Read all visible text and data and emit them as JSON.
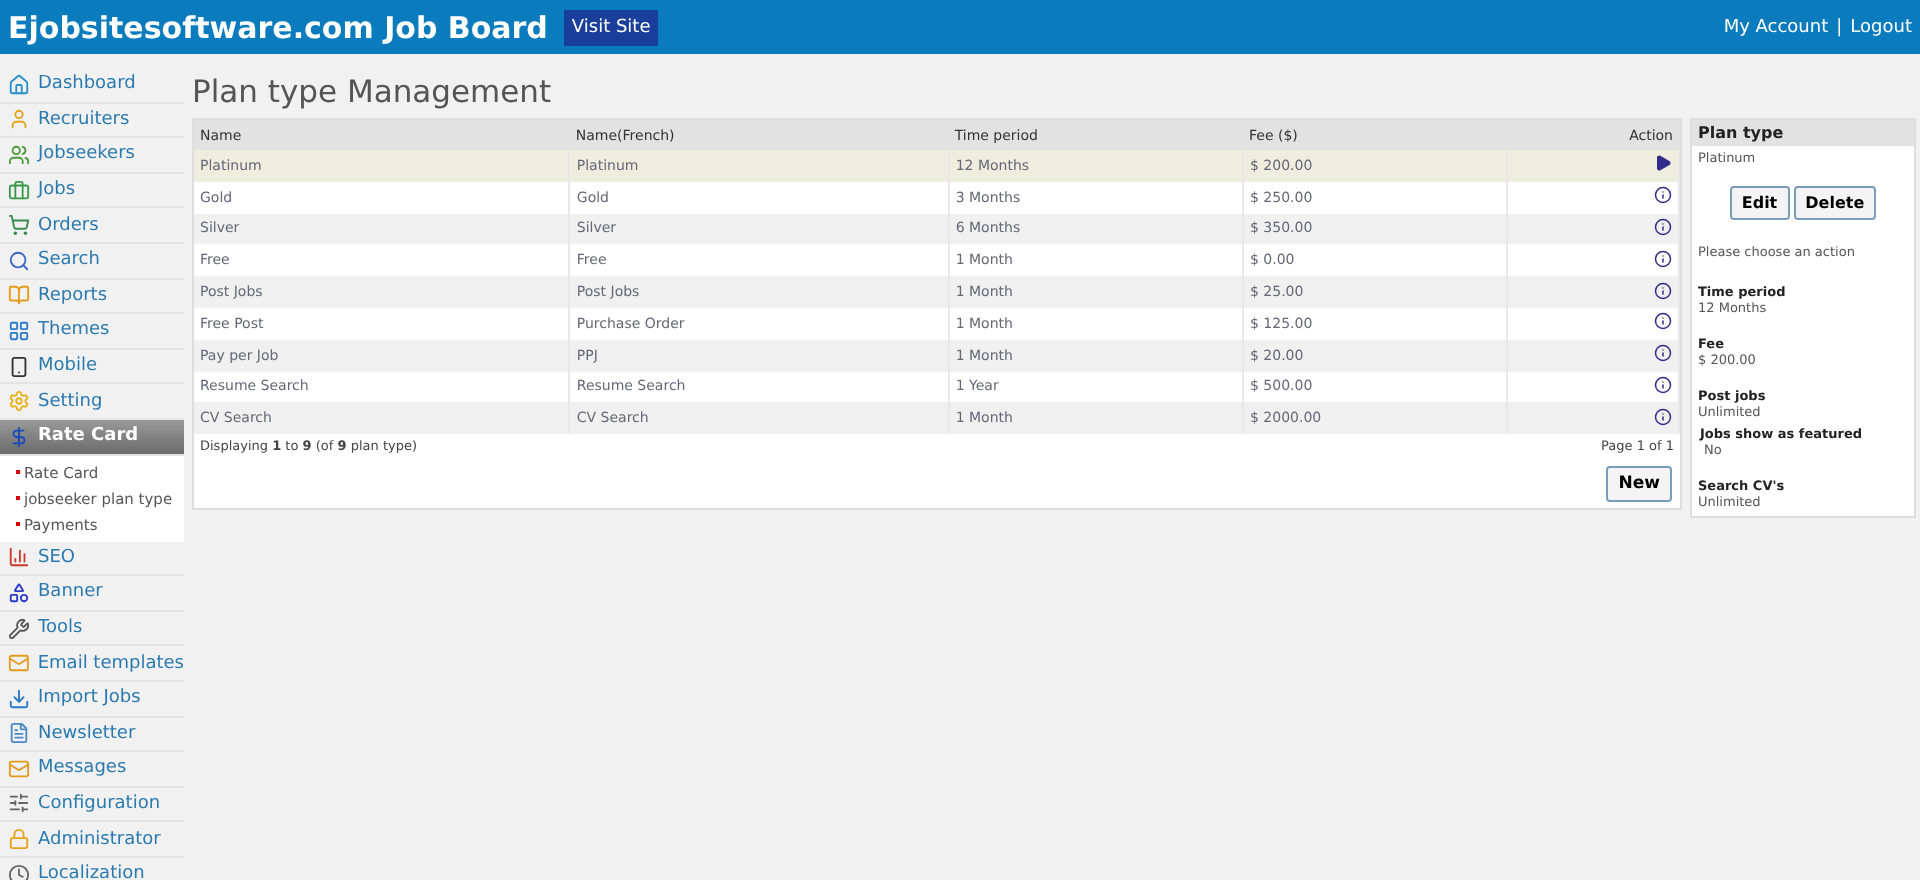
{
  "header": {
    "title": "Ejobsitesoftware.com Job Board",
    "visit_button": "Visit Site",
    "links": [
      "My Account",
      "Logout"
    ],
    "separator": "|"
  },
  "sidebar": {
    "items": [
      {
        "label": "Dashboard",
        "selected": false
      },
      {
        "label": "Recruiters",
        "selected": false
      },
      {
        "label": "Jobseekers",
        "selected": false
      },
      {
        "label": "Jobs",
        "selected": false
      },
      {
        "label": "Orders",
        "selected": false
      },
      {
        "label": "Search",
        "selected": false
      },
      {
        "label": "Reports",
        "selected": false
      },
      {
        "label": "Themes",
        "selected": false
      },
      {
        "label": "Mobile",
        "selected": false
      },
      {
        "label": "Setting",
        "selected": false
      },
      {
        "label": "Rate Card",
        "selected": true,
        "children": [
          {
            "label": "Rate Card"
          },
          {
            "label": "jobseeker plan type"
          },
          {
            "label": "Payments"
          }
        ]
      },
      {
        "label": "SEO",
        "selected": false
      },
      {
        "label": "Banner",
        "selected": false
      },
      {
        "label": "Tools",
        "selected": false
      },
      {
        "label": "Email templates",
        "selected": false
      },
      {
        "label": "Import Jobs",
        "selected": false
      },
      {
        "label": "Newsletter",
        "selected": false
      },
      {
        "label": "Messages",
        "selected": false
      },
      {
        "label": "Configuration",
        "selected": false
      },
      {
        "label": "Administrator",
        "selected": false
      },
      {
        "label": "Localization",
        "selected": false
      }
    ]
  },
  "page_title": "Plan type Management",
  "table": {
    "columns": [
      "Name",
      "Name(French)",
      "Time period",
      "Fee ($)",
      "Action"
    ],
    "rows": [
      {
        "cells": [
          "Platinum",
          "Platinum",
          "12 Months",
          "$ 200.00"
        ],
        "selected": true
      },
      {
        "cells": [
          "Gold",
          "Gold",
          "3 Months",
          "$ 250.00"
        ],
        "selected": false
      },
      {
        "cells": [
          "Silver",
          "Silver",
          "6 Months",
          "$ 350.00"
        ],
        "selected": false
      },
      {
        "cells": [
          "Free",
          "Free",
          "1 Month",
          "$ 0.00"
        ],
        "selected": false
      },
      {
        "cells": [
          "Post Jobs",
          "Post Jobs",
          "1 Month",
          "$ 25.00"
        ],
        "selected": false
      },
      {
        "cells": [
          "Free Post",
          "Purchase Order",
          "1 Month",
          "$ 125.00"
        ],
        "selected": false
      },
      {
        "cells": [
          "Pay per Job",
          "PPJ",
          "1 Month",
          "$ 20.00"
        ],
        "selected": false
      },
      {
        "cells": [
          "Resume Search",
          "Resume Search",
          "1 Year",
          "$ 500.00"
        ],
        "selected": false
      },
      {
        "cells": [
          "CV Search",
          "CV Search",
          "1 Month",
          "$ 2000.00"
        ],
        "selected": false
      }
    ],
    "summary": "Displaying **1** to **9** (of **9** plan type)",
    "pager": "Page 1 of 1",
    "new_button": "New"
  },
  "details": {
    "title": "Plan type",
    "name": "Platinum",
    "buttons": [
      "Edit",
      "Delete"
    ],
    "prompt": "Please choose an action",
    "fields": [
      {
        "label": "Time period",
        "value": "12 Months"
      },
      {
        "label": "Fee",
        "value": "$ 200.00"
      },
      {
        "label": "Post jobs",
        "value": "Unlimited"
      },
      {
        "label": "Jobs show as featured",
        "value": "No",
        "indented": true
      },
      {
        "label": "Search CV's",
        "value": "Unlimited"
      }
    ]
  }
}
